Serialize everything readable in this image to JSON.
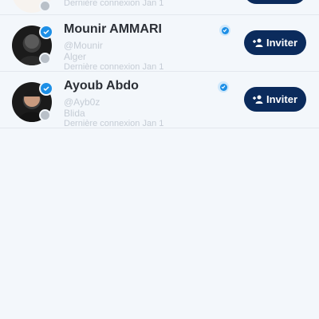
{
  "users": [
    {
      "name": "",
      "handle": "",
      "location": "",
      "last_seen": "Dernière connexion Jan 1",
      "invite_label": "",
      "avatar_icon": "user-photo"
    },
    {
      "name": "Mounir AMMARI",
      "handle": "@Mounir",
      "location": "Alger",
      "last_seen": "Dernière connexion Jan 1",
      "invite_label": "Inviter",
      "avatar_icon": "user-photo"
    },
    {
      "name": "Ayoub Abdo",
      "handle": "@Ayb0z",
      "location": "Blida",
      "last_seen": "Dernière connexion Jan 1",
      "invite_label": "Inviter",
      "avatar_icon": "user-photo"
    }
  ],
  "colors": {
    "accent": "#0b2b5c",
    "verified": "#1d8fe6",
    "muted": "#c5ccd5",
    "background": "#f3f7fb"
  }
}
